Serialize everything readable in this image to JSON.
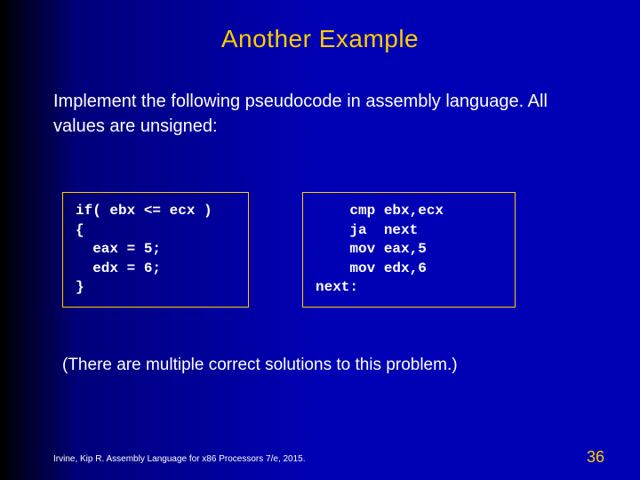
{
  "title": "Another Example",
  "description": "Implement the following pseudocode in assembly language. All values are unsigned:",
  "code_left": "if( ebx <= ecx )\n{\n  eax = 5;\n  edx = 6;\n}",
  "code_right": "    cmp ebx,ecx\n    ja  next\n    mov eax,5\n    mov edx,6\nnext:",
  "note": "(There are multiple correct solutions to this problem.)",
  "footer": "Irvine, Kip R. Assembly Language for x86 Processors 7/e, 2015.",
  "page_number": "36"
}
